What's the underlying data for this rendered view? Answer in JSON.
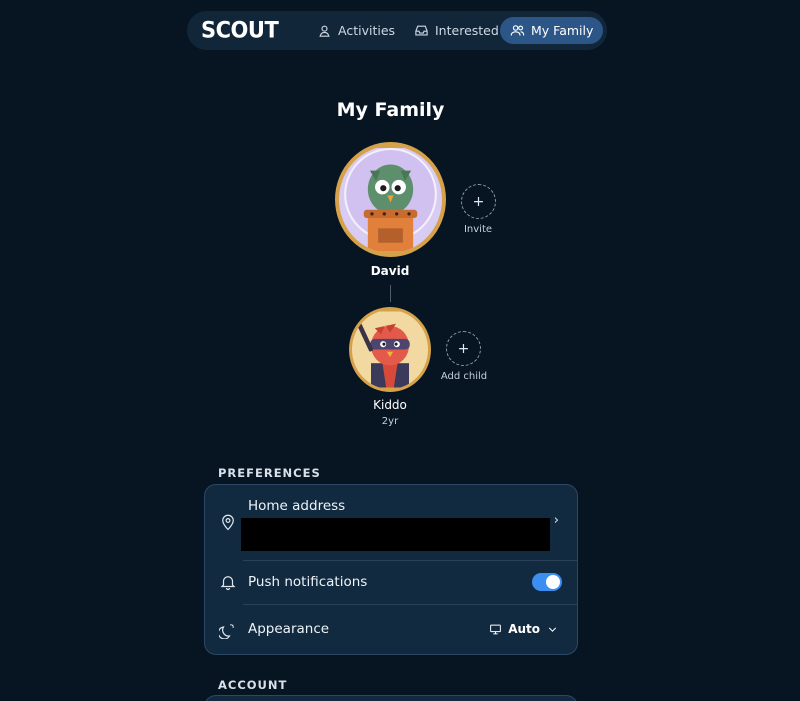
{
  "nav": {
    "logo": "SCOUT",
    "items": [
      {
        "label": "Activities",
        "icon": "pin-user-icon",
        "active": false
      },
      {
        "label": "Interested",
        "icon": "inbox-icon",
        "active": false
      },
      {
        "label": "My Family",
        "icon": "users-icon",
        "active": true
      }
    ]
  },
  "page": {
    "title": "My Family"
  },
  "family": {
    "parent": {
      "name": "David",
      "avatar": "owl-astronaut"
    },
    "child": {
      "name": "Kiddo",
      "age": "2yr",
      "avatar": "ninja-bird"
    },
    "invite_label": "Invite",
    "add_child_label": "Add child",
    "add_symbol": "+"
  },
  "preferences": {
    "section_label": "PREFERENCES",
    "home_address_label": "Home address",
    "push_notifications_label": "Push notifications",
    "push_notifications_enabled": true,
    "appearance_label": "Appearance",
    "appearance_value": "Auto"
  },
  "account": {
    "section_label": "ACCOUNT"
  },
  "colors": {
    "background": "#071523",
    "accent": "#3b8ff0",
    "avatar_ring": "#d5a24a",
    "card": "#112a40"
  }
}
